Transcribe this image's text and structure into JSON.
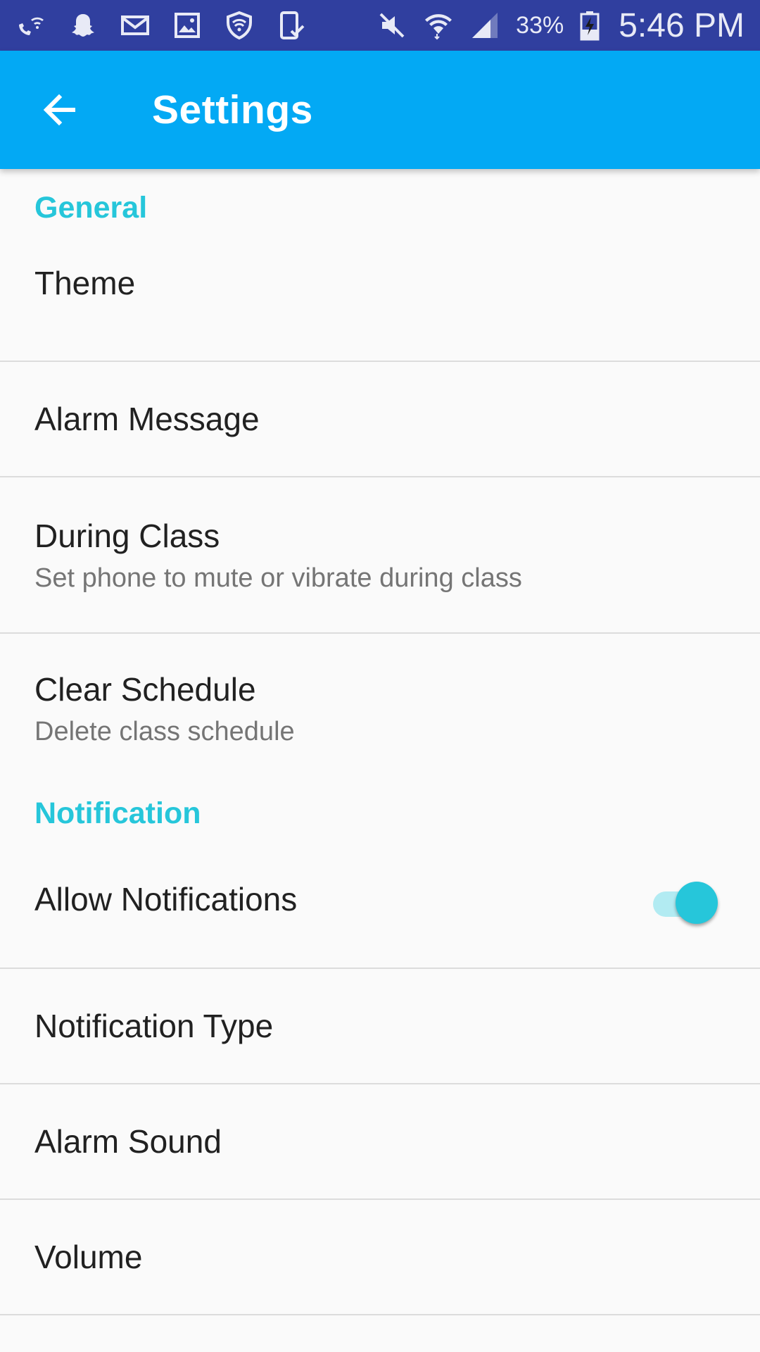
{
  "status_bar": {
    "left_icons": [
      "wifi-calling-icon",
      "snapchat-icon",
      "mail-icon",
      "image-icon",
      "shield-icon",
      "device-check-icon"
    ],
    "right_icons": [
      "mute-icon",
      "wifi-icon",
      "signal-icon",
      "battery-charging-icon"
    ],
    "battery": "33%",
    "time": "5:46 PM",
    "background_color": "#303f9f"
  },
  "app_bar": {
    "title": "Settings",
    "back_icon": "arrow-back-icon",
    "background_color": "#03a9f4"
  },
  "sections": {
    "general": {
      "header": "General",
      "items": {
        "theme": {
          "title": "Theme"
        },
        "alarm_message": {
          "title": "Alarm Message"
        },
        "during_class": {
          "title": "During Class",
          "summary": "Set phone to mute or vibrate during class"
        },
        "clear_schedule": {
          "title": "Clear Schedule",
          "summary": "Delete class schedule"
        }
      }
    },
    "notification": {
      "header": "Notification",
      "items": {
        "allow_notifications": {
          "title": "Allow Notifications",
          "enabled": true
        },
        "notification_type": {
          "title": "Notification Type"
        },
        "alarm_sound": {
          "title": "Alarm Sound"
        },
        "volume": {
          "title": "Volume"
        }
      }
    }
  },
  "colors": {
    "accent": "#26c6da",
    "divider": "#dcdcdc"
  }
}
